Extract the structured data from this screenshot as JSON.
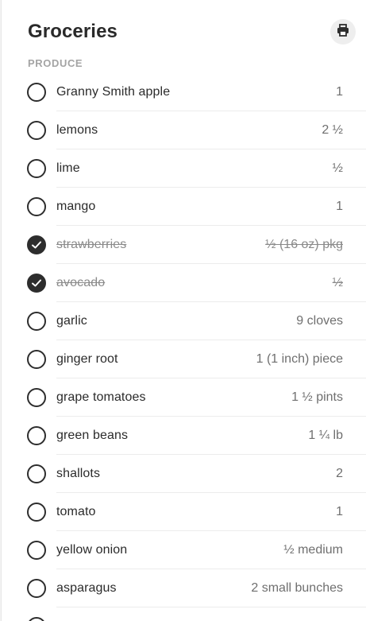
{
  "list": {
    "title": "Groceries",
    "print_icon": "printer-icon",
    "section": "PRODUCE",
    "items": [
      {
        "name": "Granny Smith apple",
        "qty": "1",
        "checked": false
      },
      {
        "name": "lemons",
        "qty": "2 ½",
        "checked": false
      },
      {
        "name": "lime",
        "qty": "½",
        "checked": false
      },
      {
        "name": "mango",
        "qty": "1",
        "checked": false
      },
      {
        "name": "strawberries",
        "qty": "½ (16 oz) pkg",
        "checked": true
      },
      {
        "name": "avocado",
        "qty": "½",
        "checked": true
      },
      {
        "name": "garlic",
        "qty": "9 cloves",
        "checked": false
      },
      {
        "name": "ginger root",
        "qty": "1 (1 inch) piece",
        "checked": false
      },
      {
        "name": "grape tomatoes",
        "qty": "1 ½ pints",
        "checked": false
      },
      {
        "name": "green beans",
        "qty": "1 ¼ lb",
        "checked": false
      },
      {
        "name": "shallots",
        "qty": "2",
        "checked": false
      },
      {
        "name": "tomato",
        "qty": "1",
        "checked": false
      },
      {
        "name": "yellow onion",
        "qty": "½ medium",
        "checked": false
      },
      {
        "name": "asparagus",
        "qty": "2 small bunches",
        "checked": false
      },
      {
        "name": "",
        "qty": "",
        "checked": false
      }
    ]
  },
  "colors": {
    "text": "#2b2b2b",
    "muted": "#a4a4a4",
    "checkbox": "#2d2d2d"
  }
}
